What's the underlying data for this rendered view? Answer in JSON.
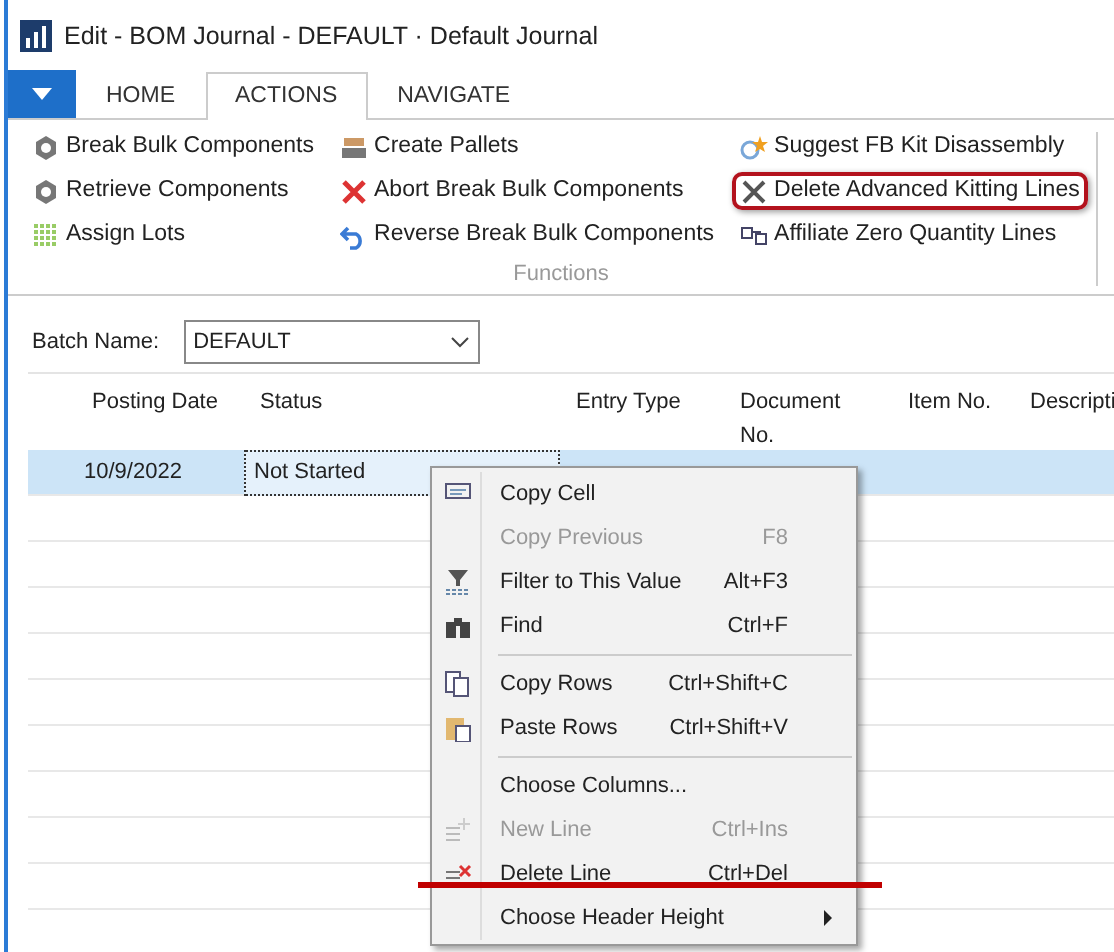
{
  "window": {
    "title": "Edit - BOM Journal - DEFAULT · Default Journal"
  },
  "tabs": [
    {
      "label": "HOME",
      "selected": false
    },
    {
      "label": "ACTIONS",
      "selected": true
    },
    {
      "label": "NAVIGATE",
      "selected": false
    }
  ],
  "ribbon": {
    "group_label": "Functions",
    "columns": [
      [
        {
          "label": "Break Bulk Components",
          "highlighted": false
        },
        {
          "label": "Retrieve Components",
          "highlighted": false
        },
        {
          "label": "Assign Lots",
          "highlighted": false
        }
      ],
      [
        {
          "label": "Create Pallets",
          "highlighted": false
        },
        {
          "label": "Abort Break Bulk Components",
          "highlighted": false
        },
        {
          "label": "Reverse Break Bulk Components",
          "highlighted": false
        }
      ],
      [
        {
          "label": "Suggest FB Kit Disassembly",
          "highlighted": false
        },
        {
          "label": "Delete Advanced Kitting Lines",
          "highlighted": true
        },
        {
          "label": "Affiliate Zero Quantity Lines",
          "highlighted": false
        }
      ]
    ]
  },
  "batch": {
    "label": "Batch Name:",
    "value": "DEFAULT"
  },
  "table": {
    "columns": [
      "Posting Date",
      "Status",
      "Entry Type",
      "Document No.",
      "Item No.",
      "Descripti"
    ],
    "rows": [
      {
        "selected": true,
        "cells": [
          "10/9/2022",
          "Not Started"
        ]
      }
    ]
  },
  "context_menu": {
    "groups": [
      [
        {
          "label": "Copy Cell",
          "disabled": false,
          "submenu": false
        },
        {
          "label": "Copy Previous",
          "shortcut": "F8",
          "disabled": true,
          "submenu": false
        },
        {
          "label": "Filter to This Value",
          "shortcut": "Alt+F3",
          "disabled": false,
          "submenu": false
        },
        {
          "label": "Find",
          "shortcut": "Ctrl+F",
          "disabled": false,
          "submenu": false
        }
      ],
      [
        {
          "label": "Copy Rows",
          "shortcut": "Ctrl+Shift+C",
          "disabled": false,
          "submenu": false
        },
        {
          "label": "Paste Rows",
          "shortcut": "Ctrl+Shift+V",
          "disabled": false,
          "submenu": false
        }
      ],
      [
        {
          "label": "Choose Columns...",
          "disabled": false,
          "submenu": false
        },
        {
          "label": "New Line",
          "shortcut": "Ctrl+Ins",
          "disabled": true,
          "submenu": false
        },
        {
          "label": "Delete Line",
          "shortcut": "Ctrl+Del",
          "disabled": false,
          "submenu": false,
          "struck": true
        },
        {
          "label": "Choose Header Height",
          "disabled": false,
          "submenu": true
        }
      ]
    ]
  }
}
